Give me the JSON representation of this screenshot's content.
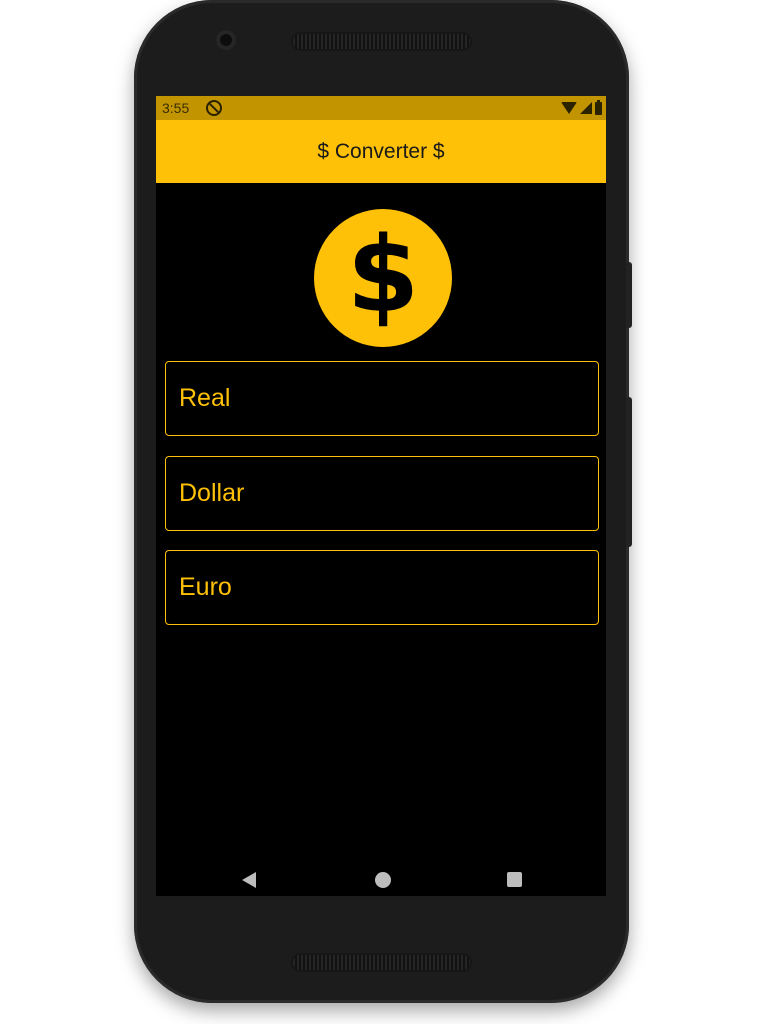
{
  "status_bar": {
    "time": "3:55",
    "icons": [
      "do-not-disturb-icon",
      "wifi-icon",
      "signal-icon",
      "battery-icon"
    ]
  },
  "app_bar": {
    "title": "$ Converter $"
  },
  "logo": {
    "icon": "dollar-coin-icon",
    "symbol": "$"
  },
  "fields": [
    {
      "label": "Real"
    },
    {
      "label": "Dollar"
    },
    {
      "label": "Euro"
    }
  ],
  "nav_bar": {
    "icons": [
      "back-icon",
      "home-icon",
      "recents-icon"
    ]
  },
  "colors": {
    "accent": "#ffc107",
    "status_bar": "#c29400",
    "background": "#000000",
    "frame": "#1c1c1c"
  }
}
